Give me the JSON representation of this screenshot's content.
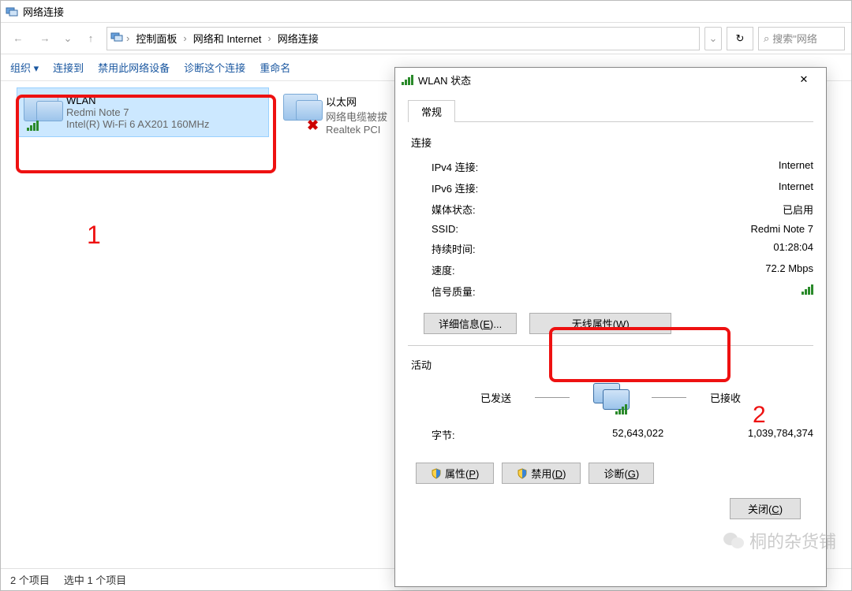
{
  "window": {
    "title": "网络连接",
    "breadcrumb": {
      "segments": [
        "控制面板",
        "网络和 Internet",
        "网络连接"
      ],
      "separator": "›"
    },
    "search_placeholder": "搜索\"网络",
    "toolbar": {
      "organize": "组织 ▾",
      "connect_to": "连接到",
      "disable": "禁用此网络设备",
      "diagnose": "诊断这个连接",
      "rename": "重命名"
    },
    "items": [
      {
        "name": "WLAN",
        "line2": "Redmi Note 7",
        "line3": "Intel(R) Wi-Fi 6 AX201 160MHz",
        "selected": true
      },
      {
        "name": "以太网",
        "line2": "网络电缆被拔",
        "line3": "Realtek PCI"
      }
    ],
    "status_bar": {
      "count": "2 个项目",
      "selected": "选中 1 个项目"
    }
  },
  "dialog": {
    "title": "WLAN 状态",
    "tab": "常规",
    "section_connection": "连接",
    "rows": {
      "ipv4_k": "IPv4 连接:",
      "ipv4_v": "Internet",
      "ipv6_k": "IPv6 连接:",
      "ipv6_v": "Internet",
      "media_k": "媒体状态:",
      "media_v": "已启用",
      "ssid_k": "SSID:",
      "ssid_v": "Redmi Note 7",
      "duration_k": "持续时间:",
      "duration_v": "01:28:04",
      "speed_k": "速度:",
      "speed_v": "72.2 Mbps",
      "quality_k": "信号质量:"
    },
    "buttons": {
      "details_pre": "详细信息(",
      "details_u": "E",
      "details_post": ")...",
      "wireless_pre": "无线属性(",
      "wireless_u": "W",
      "wireless_post": ")",
      "props_pre": "属性(",
      "props_u": "P",
      "props_post": ")",
      "disable_pre": "禁用(",
      "disable_u": "D",
      "disable_post": ")",
      "diag_pre": "诊断(",
      "diag_u": "G",
      "diag_post": ")",
      "close_pre": "关闭(",
      "close_u": "C",
      "close_post": ")"
    },
    "section_activity": "活动",
    "activity": {
      "sent": "已发送",
      "recv": "已接收"
    },
    "bytes": {
      "label": "字节:",
      "sent": "52,643,022",
      "recv": "1,039,784,374"
    }
  },
  "annotations": {
    "one": "1",
    "two": "2"
  },
  "watermark": "桐的杂货铺"
}
